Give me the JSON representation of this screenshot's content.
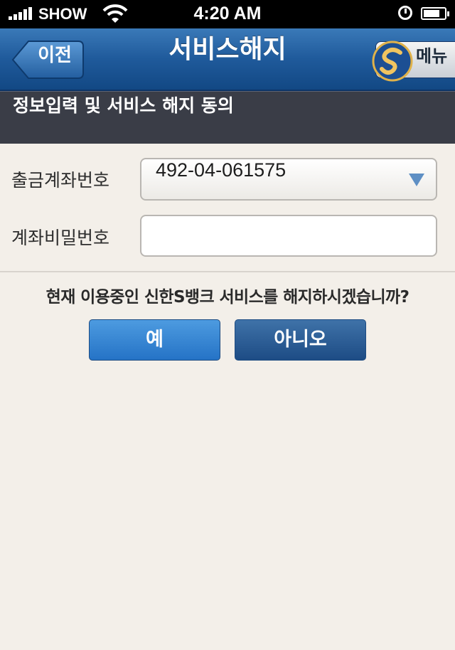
{
  "status_bar": {
    "carrier": "SHOW",
    "time": "4:20 AM"
  },
  "nav": {
    "back_label": "이전",
    "title": "서비스해지",
    "menu_label": "메뉴"
  },
  "section": {
    "title": "정보입력 및 서비스 해지 동의"
  },
  "form": {
    "account_label": "출금계좌번호",
    "account_value": "492-04-061575",
    "password_label": "계좌비밀번호",
    "password_value": ""
  },
  "confirm": {
    "question": "현재 이용중인 신한S뱅크 서비스를 해지하시겠습니까?",
    "yes_label": "예",
    "no_label": "아니오"
  },
  "colors": {
    "nav_blue": "#1f5a9b",
    "section_bg": "#3a3d47",
    "page_bg": "#f3efe9",
    "yes_button": "#2f80d2",
    "no_button": "#2a5b93"
  }
}
